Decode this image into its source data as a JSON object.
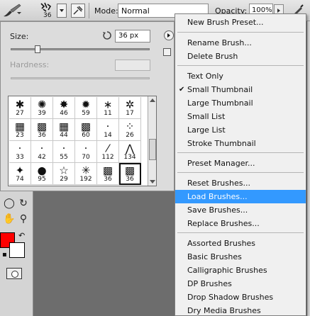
{
  "options_bar": {
    "brush_size_number": "36",
    "mode_label": "Mode:",
    "mode_value": "Normal",
    "opacity_label": "Opacity:",
    "opacity_value": "100%",
    "icons": [
      "brush-tool-icon",
      "brush-preset-icon",
      "airbrush-icon",
      "tablet-pressure-icon"
    ]
  },
  "brush_picker": {
    "size_label": "Size:",
    "size_value": "36 px",
    "hardness_label": "Hardness:",
    "size_fraction": 0.18,
    "presets": [
      {
        "num": "27",
        "glyph": "✱"
      },
      {
        "num": "39",
        "glyph": "✺"
      },
      {
        "num": "46",
        "glyph": "✸"
      },
      {
        "num": "59",
        "glyph": "✹"
      },
      {
        "num": "11",
        "glyph": "∗"
      },
      {
        "num": "17",
        "glyph": "✲"
      },
      {
        "num": "23",
        "glyph": "▦"
      },
      {
        "num": "36",
        "glyph": "▩"
      },
      {
        "num": "44",
        "glyph": "▦"
      },
      {
        "num": "60",
        "glyph": "▩"
      },
      {
        "num": "14",
        "glyph": "·"
      },
      {
        "num": "26",
        "glyph": "⁘"
      },
      {
        "num": "33",
        "glyph": "·"
      },
      {
        "num": "42",
        "glyph": "·"
      },
      {
        "num": "55",
        "glyph": "·"
      },
      {
        "num": "70",
        "glyph": "·"
      },
      {
        "num": "112",
        "glyph": "⁄"
      },
      {
        "num": "134",
        "glyph": "⋀"
      },
      {
        "num": "74",
        "glyph": "✦"
      },
      {
        "num": "95",
        "glyph": "●"
      },
      {
        "num": "29",
        "glyph": "☆"
      },
      {
        "num": "192",
        "glyph": "✳"
      },
      {
        "num": "36",
        "glyph": "▩"
      },
      {
        "num": "36",
        "glyph": "▩"
      }
    ],
    "selected_index": 23
  },
  "toolbox": {
    "colors": {
      "foreground": "#ff0000",
      "background": "#ffffff"
    }
  },
  "menu": {
    "items": [
      "New Brush Preset...",
      "Rename Brush...",
      "Delete Brush",
      "Text Only",
      "Small Thumbnail",
      "Large Thumbnail",
      "Small List",
      "Large List",
      "Stroke Thumbnail",
      "Preset Manager...",
      "Reset Brushes...",
      "Load Brushes...",
      "Save Brushes...",
      "Replace Brushes...",
      "Assorted Brushes",
      "Basic Brushes",
      "Calligraphic Brushes",
      "DP Brushes",
      "Drop Shadow Brushes",
      "Dry Media Brushes"
    ],
    "checked_item": "Small Thumbnail",
    "highlighted_item": "Load Brushes...",
    "highlight_color": "#3399ff"
  }
}
